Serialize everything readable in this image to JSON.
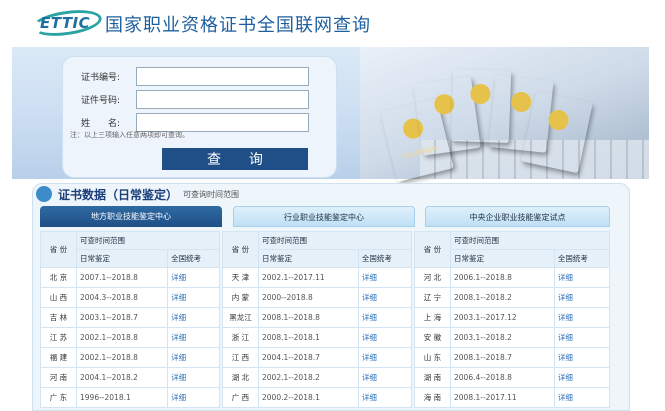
{
  "header": {
    "logo_text": "ETTIC",
    "title": "国家职业资格证书全国联网查询"
  },
  "search_form": {
    "fields": [
      {
        "label": "证书编号:",
        "value": "",
        "placeholder": ""
      },
      {
        "label": "证件号码:",
        "value": "",
        "placeholder": ""
      },
      {
        "label": "姓　　名:",
        "value": "",
        "placeholder": ""
      }
    ],
    "hint": "注：以上三项输入任意两项即可查询。",
    "submit_label": "查 询"
  },
  "certificates": [
    {
      "color": "#b3262b",
      "text": "职业资格证书"
    },
    {
      "color": "#8a1f3a",
      "text": ""
    },
    {
      "color": "#d23a6b",
      "text": ""
    },
    {
      "color": "#6a2b8a",
      "text": ""
    },
    {
      "color": "#1f6b5a",
      "text": ""
    },
    {
      "color": "#c0282c",
      "text": ""
    }
  ],
  "section": {
    "title": "证书数据（日常鉴定）",
    "subtitle": "可查询时间范围",
    "tabs": [
      {
        "label": "地方职业技能鉴定中心",
        "active": true
      },
      {
        "label": "行业职业技能鉴定中心",
        "active": false
      },
      {
        "label": "中央企业职业技能鉴定试点",
        "active": false
      }
    ]
  },
  "table": {
    "col_province": "省 份",
    "col_range": "可查时间范围",
    "col_daily": "日常鉴定",
    "col_national": "全国统考",
    "groups": [
      {
        "rows": [
          {
            "province": "北 京",
            "range": "2007.1--2018.8",
            "link": "详细"
          },
          {
            "province": "山 西",
            "range": "2004.3--2018.8",
            "link": "详细"
          },
          {
            "province": "吉 林",
            "range": "2003.1--2018.7",
            "link": "详细"
          },
          {
            "province": "江 苏",
            "range": "2002.1--2018.8",
            "link": "详细"
          },
          {
            "province": "福 建",
            "range": "2002.1--2018.8",
            "link": "详细"
          },
          {
            "province": "河 南",
            "range": "2004.1--2018.2",
            "link": "详细"
          },
          {
            "province": "广 东",
            "range": "1996--2018.1",
            "link": "详细"
          }
        ]
      },
      {
        "rows": [
          {
            "province": "天 津",
            "range": "2002.1--2017.11",
            "link": "详细"
          },
          {
            "province": "内 蒙",
            "range": "2000--2018.8",
            "link": "详细"
          },
          {
            "province": "黑龙江",
            "range": "2008.1--2018.8",
            "link": "详细"
          },
          {
            "province": "浙 江",
            "range": "2008.1--2018.1",
            "link": "详细"
          },
          {
            "province": "江 西",
            "range": "2004.1--2018.7",
            "link": "详细"
          },
          {
            "province": "湖 北",
            "range": "2002.1--2018.2",
            "link": "详细"
          },
          {
            "province": "广 西",
            "range": "2000.2--2018.1",
            "link": "详细"
          }
        ]
      },
      {
        "rows": [
          {
            "province": "河 北",
            "range": "2006.1--2018.8",
            "link": "详细"
          },
          {
            "province": "辽 宁",
            "range": "2008.1--2018.2",
            "link": "详细"
          },
          {
            "province": "上 海",
            "range": "2003.1--2017.12",
            "link": "详细"
          },
          {
            "province": "安 徽",
            "range": "2003.1--2018.2",
            "link": "详细"
          },
          {
            "province": "山 东",
            "range": "2008.1--2018.7",
            "link": "详细"
          },
          {
            "province": "湖 南",
            "range": "2006.4--2018.8",
            "link": "详细"
          },
          {
            "province": "海 南",
            "range": "2008.1--2017.11",
            "link": "详细"
          }
        ]
      }
    ]
  }
}
